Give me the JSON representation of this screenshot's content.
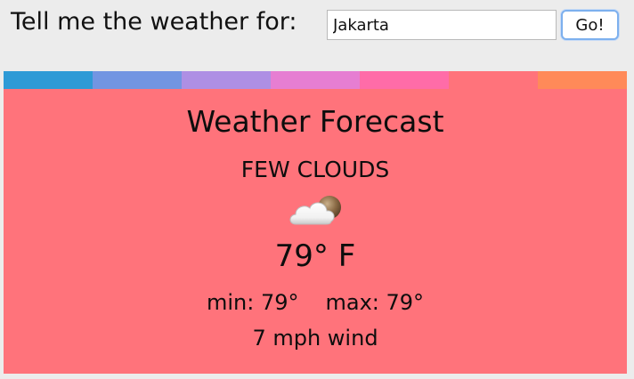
{
  "search": {
    "prompt": "Tell me the weather for:",
    "city_value": "Jakarta",
    "go_label": "Go!"
  },
  "colors": {
    "page_background": "#ececec",
    "card_background": "#ff737b",
    "stripes": [
      "#2e9ad6",
      "#7295e2",
      "#ae8fe4",
      "#e67ed2",
      "#ff6ca8",
      "#ff737b",
      "#ff8a59"
    ]
  },
  "forecast": {
    "title": "Weather Forecast",
    "condition": "FEW CLOUDS",
    "icon": "few-clouds-icon",
    "temperature": "79° F",
    "min": "min: 79°",
    "max": "max: 79°",
    "wind": "7 mph wind"
  }
}
